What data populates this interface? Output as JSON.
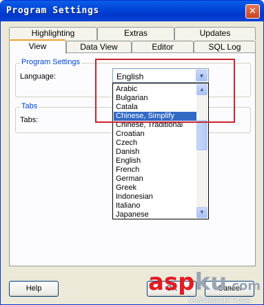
{
  "window": {
    "title": "Program Settings",
    "close_glyph": "✕"
  },
  "tabs_back": [
    {
      "label": "Highlighting"
    },
    {
      "label": "Extras"
    },
    {
      "label": "Updates"
    }
  ],
  "tabs_front": [
    {
      "label": "View",
      "active": true
    },
    {
      "label": "Data View"
    },
    {
      "label": "Editor"
    },
    {
      "label": "SQL Log"
    }
  ],
  "program_settings": {
    "group_title": "Program Settings",
    "language_label": "Language:",
    "language_value": "English"
  },
  "tabs_group": {
    "group_title": "Tabs",
    "tabs_label": "Tabs:"
  },
  "language_dropdown": {
    "options": [
      "Arabic",
      "Bulgarian",
      "Catala",
      "Chinese, Simplify",
      "Chinese, Traditional",
      "Croatian",
      "Czech",
      "Danish",
      "English",
      "French",
      "German",
      "Greek",
      "Indonesian",
      "Italiano",
      "Japanese"
    ],
    "selected": "Chinese, Simplify"
  },
  "buttons": {
    "help": {
      "label": "Help",
      "mnemonic": "H"
    },
    "ok": {
      "label": "OK"
    },
    "cancel": {
      "label": "Cancel"
    }
  },
  "watermark": {
    "part1": "asp",
    "part2": "ku",
    "part3": ".com",
    "sub": "免费网络编程下载站"
  },
  "colors": {
    "titlebar": "#0054e3",
    "accent_tab": "#f0a030",
    "selection": "#316ac5",
    "highlight_box": "#c8242e",
    "group_title": "#0046d5"
  }
}
